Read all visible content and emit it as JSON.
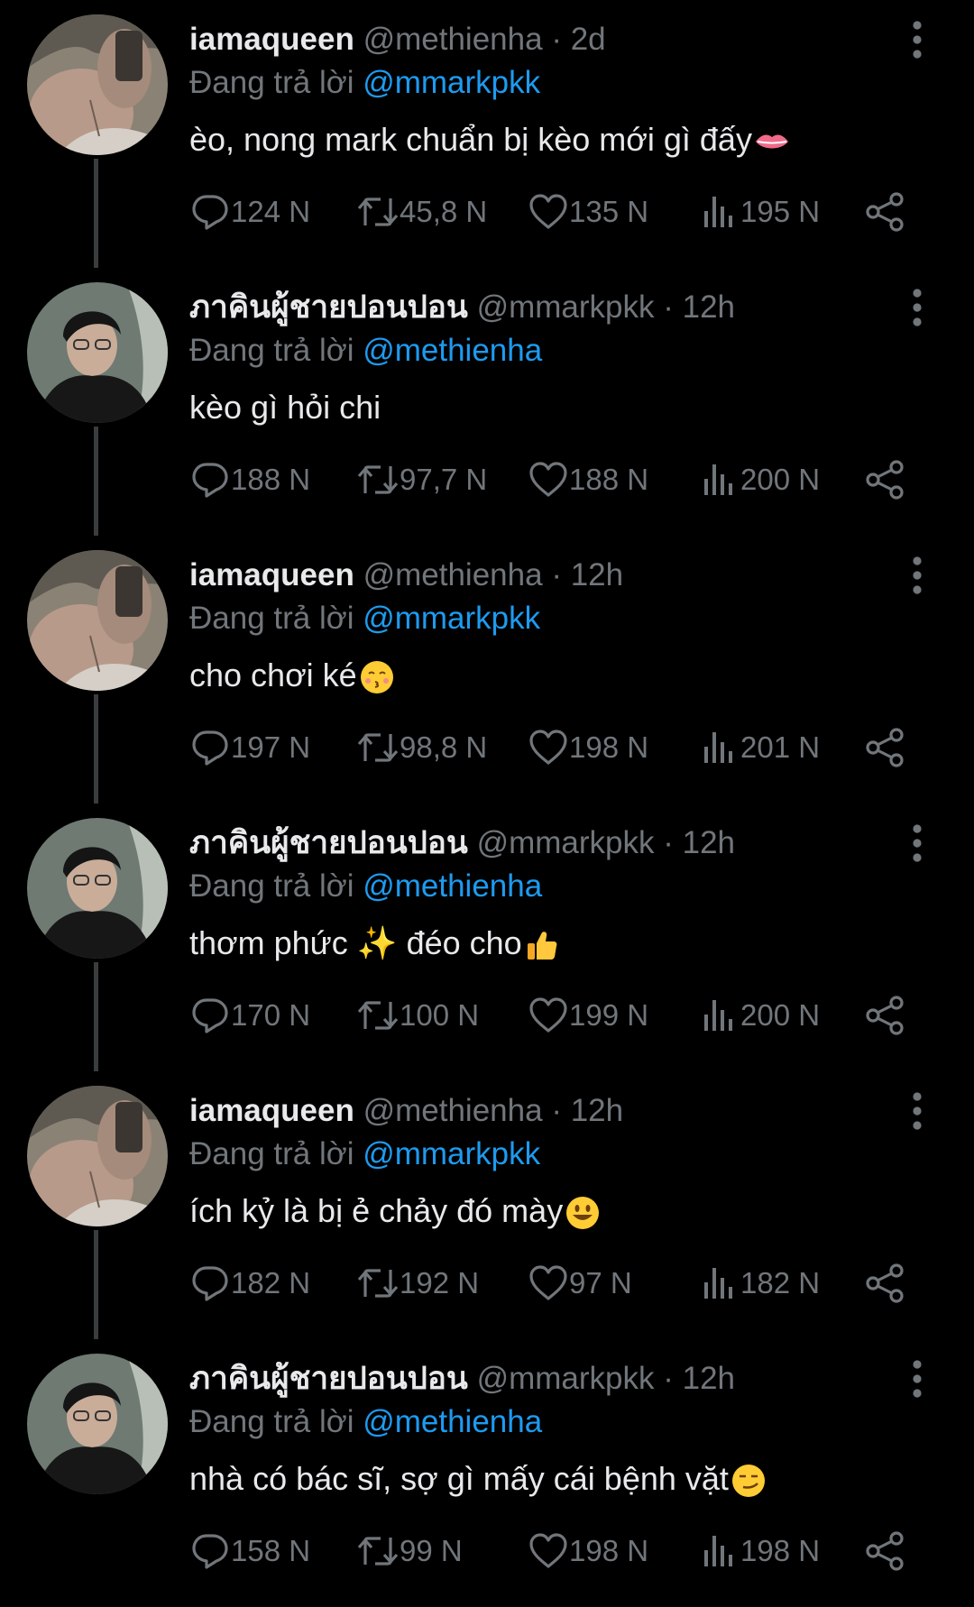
{
  "reply_prefix": "Đang trả lời",
  "tweets": [
    {
      "author": "iamaqueen",
      "handle": "@methienha",
      "time": "2d",
      "reply_to": "@mmarkpkk",
      "text": "èo, nong mark chuẩn bị kèo mới gì đấy",
      "emoji": "lips-emoji",
      "replies": "124 N",
      "retweets": "45,8 N",
      "likes": "135 N",
      "views": "195 N",
      "avatar": "queen"
    },
    {
      "author": "ภาคินผู้ชายปอนปอน",
      "handle": "@mmarkpkk",
      "time": "12h",
      "reply_to": "@methienha",
      "text": "kèo gì hỏi chi",
      "emoji": "",
      "replies": "188 N",
      "retweets": "97,7 N",
      "likes": "188 N",
      "views": "200 N",
      "avatar": "mark"
    },
    {
      "author": "iamaqueen",
      "handle": "@methienha",
      "time": "12h",
      "reply_to": "@mmarkpkk",
      "text": "cho chơi ké",
      "emoji": "kissing-face-emoji",
      "replies": "197 N",
      "retweets": "98,8 N",
      "likes": "198 N",
      "views": "201 N",
      "avatar": "queen"
    },
    {
      "author": "ภาคินผู้ชายปอนปอน",
      "handle": "@mmarkpkk",
      "time": "12h",
      "reply_to": "@methienha",
      "text": "thơm phức ✨ đéo cho",
      "emoji": "thumbs-up-emoji",
      "replies": "170 N",
      "retweets": "100 N",
      "likes": "199 N",
      "views": "200 N",
      "avatar": "mark"
    },
    {
      "author": "iamaqueen",
      "handle": "@methienha",
      "time": "12h",
      "reply_to": "@mmarkpkk",
      "text": "ích kỷ là bị ẻ chảy đó mày",
      "emoji": "smiley-face-emoji",
      "replies": "182 N",
      "retweets": "192 N",
      "likes": "97 N",
      "views": "182 N",
      "avatar": "queen"
    },
    {
      "author": "ภาคินผู้ชายปอนปอน",
      "handle": "@mmarkpkk",
      "time": "12h",
      "reply_to": "@methienha",
      "text": "nhà có bác sĩ, sợ gì mấy cái bệnh vặt",
      "emoji": "smirk-face-emoji",
      "replies": "158 N",
      "retweets": "99 N",
      "likes": "198 N",
      "views": "198 N",
      "avatar": "mark"
    }
  ],
  "icons": {
    "reply": "reply-icon",
    "retweet": "retweet-icon",
    "like": "heart-icon",
    "views": "views-icon",
    "share": "share-icon",
    "more": "more-vertical-icon"
  },
  "colors": {
    "background": "#000000",
    "text": "#e7e9ea",
    "muted": "#71767b",
    "mention": "#1d9bf0",
    "thread_line": "#3a3d40"
  }
}
